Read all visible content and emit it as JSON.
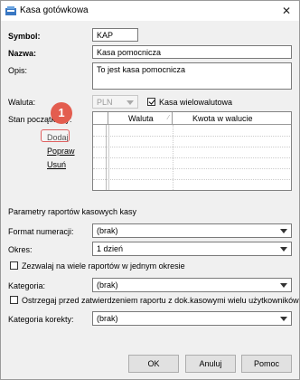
{
  "window": {
    "title": "Kasa gotówkowa",
    "close_symbol": "✕"
  },
  "form": {
    "symbol_label": "Symbol:",
    "symbol_value": "KAP",
    "nazwa_label": "Nazwa:",
    "nazwa_value": "Kasa pomocnicza",
    "opis_label": "Opis:",
    "opis_value": "To jest kasa pomocnicza",
    "waluta_label": "Waluta:",
    "waluta_value": "PLN",
    "multi_currency_label": "Kasa wielowalutowa",
    "multi_currency_checked": true,
    "stan_label": "Stan początkowy:",
    "grid_headers": [
      "Waluta",
      "Kwota w walucie"
    ],
    "actions": {
      "add": "Dodaj",
      "edit": "Popraw",
      "delete": "Usuń"
    }
  },
  "report_params": {
    "section_label": "Parametry raportów kasowych kasy",
    "format_label": "Format numeracji:",
    "format_value": "(brak)",
    "okres_label": "Okres:",
    "okres_value": "1 dzień",
    "multi_reports_label": "Zezwalaj na wiele raportów w jednym okresie",
    "kategoria_label": "Kategoria:",
    "kategoria_value": "(brak)",
    "warn_label": "Ostrzegaj przed zatwierdzeniem raportu z dok.kasowymi wielu użytkowników",
    "kategoria_korekty_label": "Kategoria korekty:",
    "kategoria_korekty_value": "(brak)"
  },
  "buttons": {
    "ok": "OK",
    "cancel": "Anuluj",
    "help": "Pomoc"
  },
  "annotation": {
    "step": "1",
    "color": "#e35d4f"
  }
}
